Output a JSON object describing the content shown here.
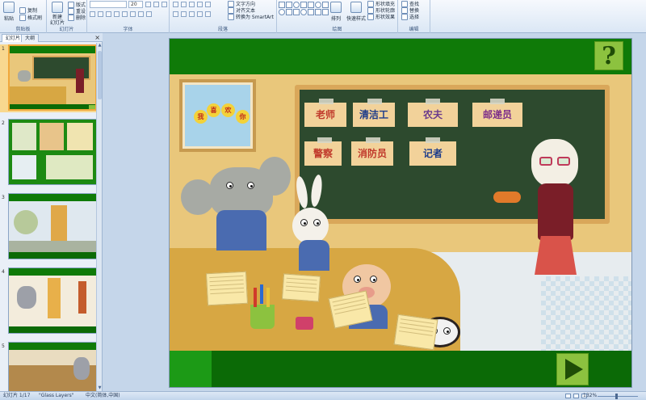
{
  "ribbon": {
    "clipboard": {
      "paste": "粘贴",
      "copy": "复制",
      "format_painter": "格式刷",
      "label": "剪贴板"
    },
    "slides": {
      "new_slide": "新建\n幻灯片",
      "layout": "版式",
      "reset": "重设",
      "delete": "删除",
      "label": "幻灯片"
    },
    "font": {
      "font_name": "",
      "font_size": "20",
      "label": "字体"
    },
    "paragraph": {
      "text_direction": "文字方向",
      "align_text": "对齐文本",
      "smartart": "转换为 SmartArt",
      "label": "段落"
    },
    "drawing": {
      "arrange": "排列",
      "quick_styles": "快速样式",
      "shape_fill": "形状填充",
      "shape_outline": "形状轮廓",
      "shape_effects": "形状效果",
      "label": "绘图"
    },
    "editing": {
      "find": "查找",
      "replace": "替换",
      "select": "选择",
      "label": "编辑"
    }
  },
  "panel": {
    "tab_slides": "幻灯片",
    "tab_outline": "大纲",
    "close": "×",
    "thumbnails": [
      {
        "num": "1",
        "selected": true
      },
      {
        "num": "2",
        "selected": false
      },
      {
        "num": "3",
        "selected": false
      },
      {
        "num": "4",
        "selected": false
      },
      {
        "num": "5",
        "selected": false
      }
    ]
  },
  "slide": {
    "help_button": "?",
    "window_flowers": [
      "我",
      "喜",
      "欢",
      "你"
    ],
    "cards": [
      "老师",
      "清洁工",
      "农夫",
      "邮递员",
      "警察",
      "消防员",
      "记者"
    ],
    "card_colors": [
      "#c0392b",
      "#1d3c8a",
      "#6a3a8c",
      "#7d2f8a",
      "#c0392b",
      "#c0392b",
      "#1d3c8a"
    ]
  },
  "status": {
    "slide_count": "幻灯片 1/17",
    "theme": "\"Glass Layers\"",
    "language": "中文(简体,中国)",
    "zoom": "132%"
  },
  "colors": {
    "topbar": "#0f7a08",
    "bottombar": "#0b6a06",
    "button_bg": "#8cc23f",
    "chalkboard": "#2d4a2e"
  }
}
